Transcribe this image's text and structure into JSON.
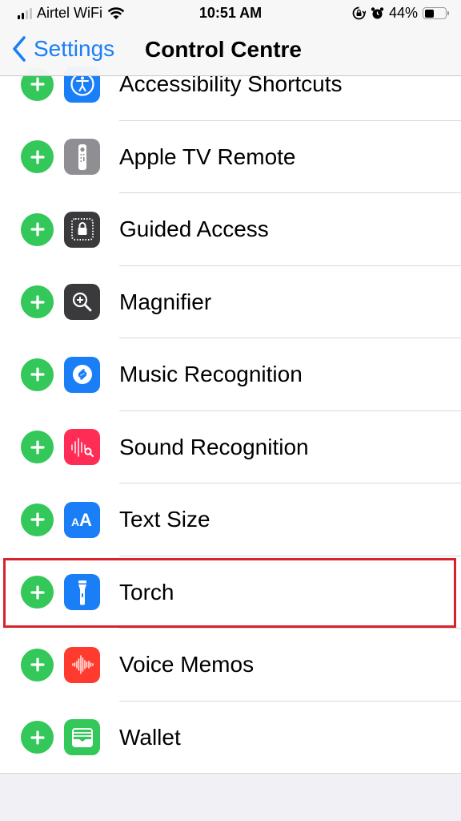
{
  "status_bar": {
    "carrier": "Airtel WiFi",
    "time": "10:51 AM",
    "battery_percent": "44%",
    "battery_level": 0.44,
    "icons": [
      "signal-icon",
      "wifi-icon",
      "orientation-lock-icon",
      "alarm-icon",
      "battery-icon"
    ]
  },
  "nav": {
    "back_label": "Settings",
    "title": "Control Centre"
  },
  "more_controls": [
    {
      "label": "Accessibility Shortcuts",
      "icon": "accessibility-icon",
      "color": "#1a7ef7"
    },
    {
      "label": "Apple TV Remote",
      "icon": "tv-remote-icon",
      "color": "#8e8e93"
    },
    {
      "label": "Guided Access",
      "icon": "guided-access-lock-icon",
      "color": "#3a3a3c"
    },
    {
      "label": "Magnifier",
      "icon": "magnifier-icon",
      "color": "#3a3a3c"
    },
    {
      "label": "Music Recognition",
      "icon": "shazam-icon",
      "color": "#1a7ef7"
    },
    {
      "label": "Sound Recognition",
      "icon": "sound-recognition-icon",
      "color": "#ff2d55"
    },
    {
      "label": "Text Size",
      "icon": "text-size-icon",
      "color": "#1a7ef7"
    },
    {
      "label": "Torch",
      "icon": "torch-icon",
      "color": "#1a7ef7"
    },
    {
      "label": "Voice Memos",
      "icon": "voice-memos-icon",
      "color": "#ff3b30"
    },
    {
      "label": "Wallet",
      "icon": "wallet-icon",
      "color": "#34c759"
    }
  ],
  "highlighted_item": "Torch",
  "colors": {
    "accent": "#1a7ef7",
    "add_green": "#34c759",
    "highlight_red": "#d6232c"
  }
}
